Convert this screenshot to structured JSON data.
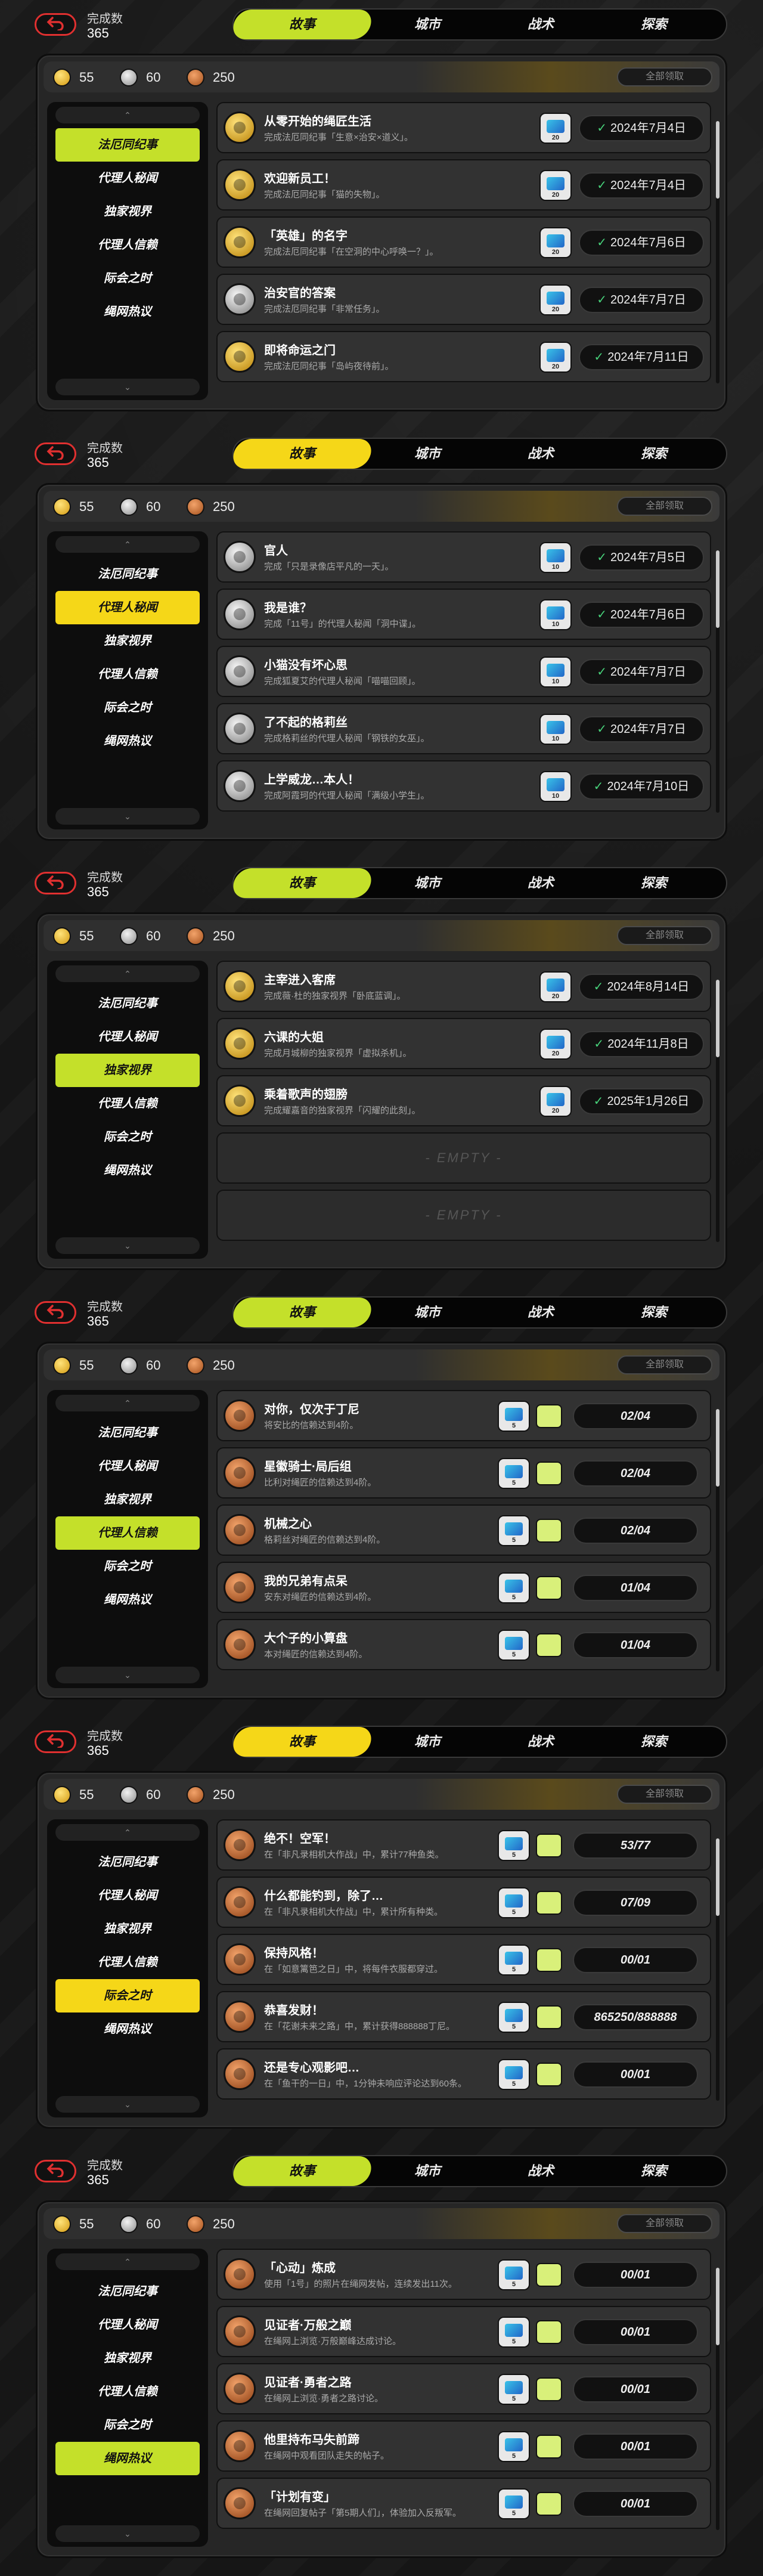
{
  "completion_label": "完成数",
  "completion_value": "365",
  "tabs": [
    "故事",
    "城市",
    "战术",
    "探索"
  ],
  "coins": [
    "55",
    "60",
    "250"
  ],
  "claim_all": "全部领取",
  "sidebar": [
    "法厄同纪事",
    "代理人秘闻",
    "独家视界",
    "代理人信赖",
    "际会之时",
    "绳网热议"
  ],
  "screens": [
    {
      "active_side": 0,
      "accent": "#c4e02a",
      "rows": [
        {
          "medal": "gold",
          "title": "从零开始的绳匠生活",
          "desc": "完成法厄同纪事「生意×治安×道义」。",
          "reward_qty": "20",
          "status": "2024年7月4日",
          "done": true
        },
        {
          "medal": "gold",
          "title": "欢迎新员工！",
          "desc": "完成法厄同纪事「猫的失物」。",
          "reward_qty": "20",
          "status": "2024年7月4日",
          "done": true
        },
        {
          "medal": "gold",
          "title": "「英雄」的名字",
          "desc": "完成法厄同纪事「在空洞的中心呼唤一？」。",
          "reward_qty": "20",
          "status": "2024年7月6日",
          "done": true
        },
        {
          "medal": "silver",
          "title": "治安官的答案",
          "desc": "完成法厄同纪事「非常任务」。",
          "reward_qty": "20",
          "status": "2024年7月7日",
          "done": true
        },
        {
          "medal": "gold",
          "title": "即将命运之门",
          "desc": "完成法厄同纪事「岛屿夜待前」。",
          "reward_qty": "20",
          "status": "2024年7月11日",
          "done": true
        }
      ]
    },
    {
      "active_side": 1,
      "accent": "#f5d718",
      "rows": [
        {
          "medal": "silver",
          "title": "官人",
          "desc": "完成「只是录像店平凡的一天」。",
          "reward_qty": "10",
          "status": "2024年7月5日",
          "done": true
        },
        {
          "medal": "silver",
          "title": "我是谁？",
          "desc": "完成「11号」的代理人秘闻「洞中谍」。",
          "reward_qty": "10",
          "status": "2024年7月6日",
          "done": true
        },
        {
          "medal": "silver",
          "title": "小猫没有坏心思",
          "desc": "完成狐夏艾的代理人秘闻「喵喵回顾」。",
          "reward_qty": "10",
          "status": "2024年7月7日",
          "done": true
        },
        {
          "medal": "silver",
          "title": "了不起的格莉丝",
          "desc": "完成格莉丝的代理人秘闻「钢铁的女巫」。",
          "reward_qty": "10",
          "status": "2024年7月7日",
          "done": true
        },
        {
          "medal": "silver",
          "title": "上学威龙…本人！",
          "desc": "完成阿霞珂的代理人秘闻「满级小学生」。",
          "reward_qty": "10",
          "status": "2024年7月10日",
          "done": true
        }
      ]
    },
    {
      "active_side": 2,
      "accent": "#c4e02a",
      "rows": [
        {
          "medal": "gold",
          "title": "主宰进入客席",
          "desc": "完成薇·杜的独家视界「卧底蓝调」。",
          "reward_qty": "20",
          "status": "2024年8月14日",
          "done": true
        },
        {
          "medal": "gold",
          "title": "六课的大姐",
          "desc": "完成月城柳的独家视界「虚拟杀机」。",
          "reward_qty": "20",
          "status": "2024年11月8日",
          "done": true
        },
        {
          "medal": "gold",
          "title": "乘着歌声的翅膀",
          "desc": "完成耀嘉音的独家视界「闪耀的此刻」。",
          "reward_qty": "20",
          "status": "2025年1月26日",
          "done": true
        },
        {
          "empty": true,
          "label": "- EMPTY -"
        },
        {
          "empty": true,
          "label": "- EMPTY -"
        }
      ]
    },
    {
      "active_side": 3,
      "accent": "#c4e02a",
      "rows": [
        {
          "medal": "bronze",
          "title": "对你，仅次于丁尼",
          "desc": "将安比的信赖达到4阶。",
          "reward_qty": "5",
          "status": "02/04",
          "progress": true
        },
        {
          "medal": "bronze",
          "title": "星徽骑士·局后组",
          "desc": "比利对绳匠的信赖达到4阶。",
          "reward_qty": "5",
          "status": "02/04",
          "progress": true
        },
        {
          "medal": "bronze",
          "title": "机械之心",
          "desc": "格莉丝对绳匠的信赖达到4阶。",
          "reward_qty": "5",
          "status": "02/04",
          "progress": true
        },
        {
          "medal": "bronze",
          "title": "我的兄弟有点呆",
          "desc": "安东对绳匠的信赖达到4阶。",
          "reward_qty": "5",
          "status": "01/04",
          "progress": true
        },
        {
          "medal": "bronze",
          "title": "大个子的小算盘",
          "desc": "本对绳匠的信赖达到4阶。",
          "reward_qty": "5",
          "status": "01/04",
          "progress": true
        }
      ]
    },
    {
      "active_side": 4,
      "accent": "#f5d718",
      "rows": [
        {
          "medal": "bronze",
          "title": "绝不！空军！",
          "desc": "在「非凡录相机大作战」中，累计77种鱼类。",
          "reward_qty": "5",
          "status": "53/77",
          "progress": true,
          "extra": true
        },
        {
          "medal": "bronze",
          "title": "什么都能钓到，除了…",
          "desc": "在「非凡录相机大作战」中，累计所有种类。",
          "reward_qty": "5",
          "status": "07/09",
          "progress": true,
          "extra": true
        },
        {
          "medal": "bronze",
          "title": "保持风格！",
          "desc": "在「如意篱笆之日」中，将每件衣服都穿过。",
          "reward_qty": "5",
          "status": "00/01",
          "progress": true
        },
        {
          "medal": "bronze",
          "title": "恭喜发财！",
          "desc": "在「花谢未来之路」中，累计获得888888丁尼。",
          "reward_qty": "5",
          "status": "865250/888888",
          "progress": true
        },
        {
          "medal": "bronze",
          "title": "还是专心观影吧…",
          "desc": "在「鱼干的一日」中，1分钟未响应评论达到60条。",
          "reward_qty": "5",
          "status": "00/01",
          "progress": true
        }
      ]
    },
    {
      "active_side": 5,
      "accent": "#c4e02a",
      "rows": [
        {
          "medal": "bronze",
          "title": "「心动」炼成",
          "desc": "使用「1号」的照片在绳网发帖，连续发出11次。",
          "reward_qty": "5",
          "status": "00/01",
          "progress": true
        },
        {
          "medal": "bronze",
          "title": "见证者·万般之巅",
          "desc": "在绳网上浏览·万般巅峰达成讨论。",
          "reward_qty": "5",
          "status": "00/01",
          "progress": true
        },
        {
          "medal": "bronze",
          "title": "见证者·勇者之路",
          "desc": "在绳网上浏览·勇者之路讨论。",
          "reward_qty": "5",
          "status": "00/01",
          "progress": true
        },
        {
          "medal": "bronze",
          "title": "他里持布马失前蹄",
          "desc": "在绳网中观看团队走失的帖子。",
          "reward_qty": "5",
          "status": "00/01",
          "progress": true
        },
        {
          "medal": "bronze",
          "title": "「计划有变」",
          "desc": "在绳网回复帖子「第5期人们」，体验加入反叛军。",
          "reward_qty": "5",
          "status": "00/01",
          "progress": true
        }
      ]
    }
  ]
}
